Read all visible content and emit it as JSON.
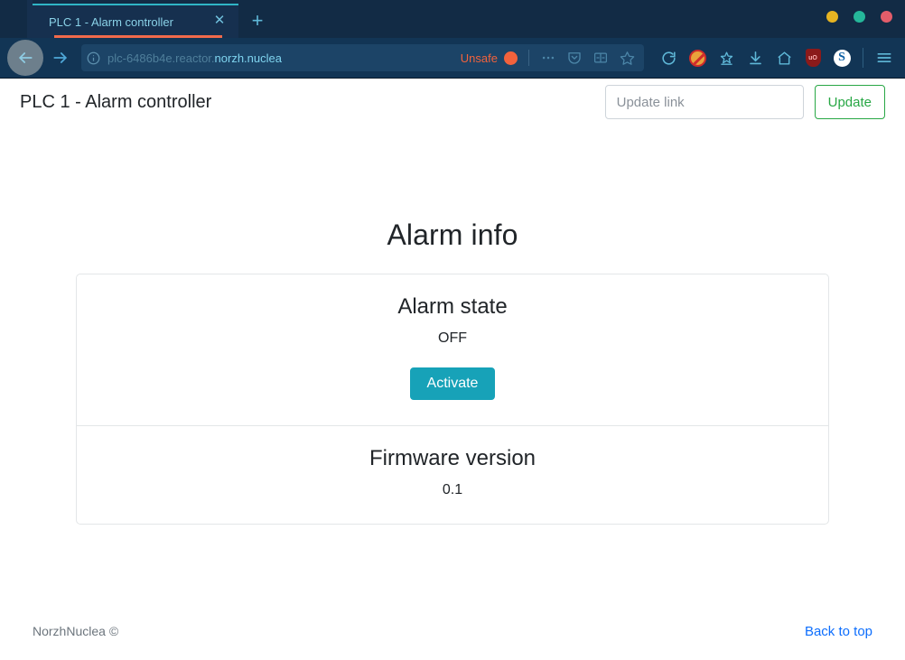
{
  "browser": {
    "tab": {
      "title": "PLC 1 - Alarm controller",
      "close_label": "✕",
      "new_tab_label": "+"
    },
    "window_controls": [
      {
        "name": "minimize",
        "color": "#e6b422"
      },
      {
        "name": "maximize",
        "color": "#25b79a"
      },
      {
        "name": "close",
        "color": "#e35d6a"
      }
    ],
    "toolbar": {
      "back_label": "←",
      "forward_label": "→",
      "url_dim": "plc-6486b4e.reactor.",
      "url_bright": "norzh.nuclea",
      "security_label": "Unsafe",
      "icons_in_urlbar": [
        "page-actions-icon",
        "pocket-icon",
        "reader-mode-icon",
        "bookmark-star-icon"
      ],
      "icons": [
        "reload-icon",
        "cookie-blocker-icon",
        "save-to-pocket-icon",
        "downloads-icon",
        "home-icon",
        "ublock-origin-icon",
        "skype-icon",
        "app-menu-icon"
      ],
      "ublock_label": "uO",
      "skype_label": "S",
      "menu_label": "☰"
    }
  },
  "page": {
    "brand": "PLC 1 - Alarm controller",
    "update_input_placeholder": "Update link",
    "update_input_value": "",
    "update_button_label": "Update",
    "section_title": "Alarm info",
    "items": [
      {
        "title": "Alarm state",
        "value": "OFF",
        "action_label": "Activate"
      },
      {
        "title": "Firmware version",
        "value": "0.1"
      }
    ],
    "footer": {
      "copyright": "NorzhNuclea ©",
      "back_to_top": "Back to top"
    }
  },
  "colors": {
    "accent_teal": "#17a2b8",
    "accent_green": "#28a745",
    "link_blue": "#0d6efd",
    "unsafe_orange": "#f2623c",
    "chrome_dark": "#123555"
  }
}
